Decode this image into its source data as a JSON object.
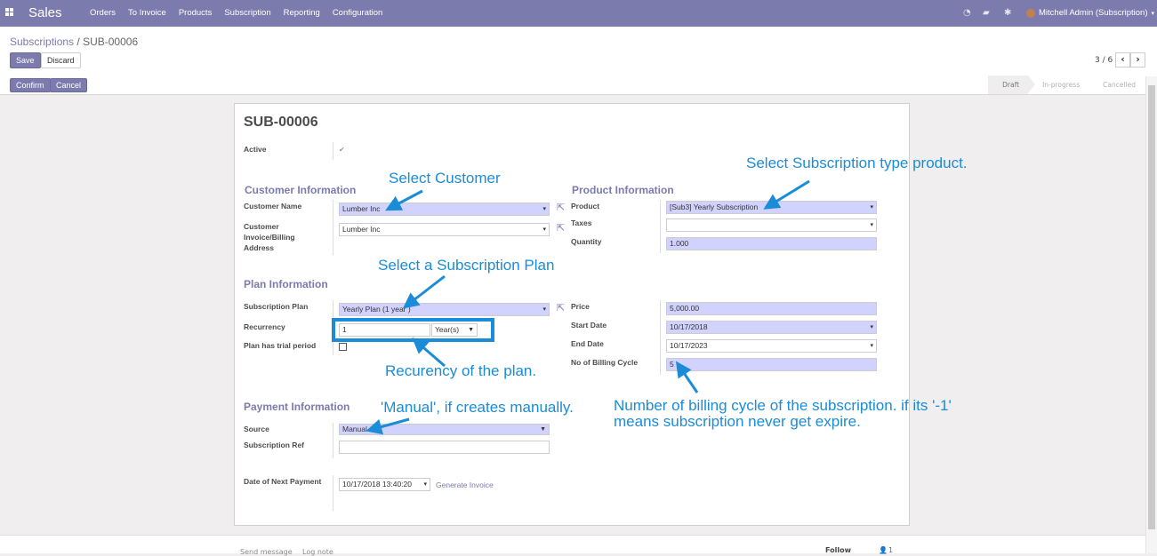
{
  "app": {
    "name": "Sales"
  },
  "nav": {
    "menu": [
      "Orders",
      "To Invoice",
      "Products",
      "Subscription",
      "Reporting",
      "Configuration"
    ],
    "user": "Mitchell Admin (Subscription)"
  },
  "breadcrumb": {
    "parent": "Subscriptions",
    "separator": "/",
    "current": "SUB-00006"
  },
  "buttons": {
    "save": "Save",
    "discard": "Discard",
    "confirm": "Confirm",
    "cancel": "Cancel"
  },
  "pager": {
    "value": "3 / 6"
  },
  "stages": [
    "Draft",
    "In-progress",
    "Cancelled"
  ],
  "form": {
    "title": "SUB-00006",
    "active_label": "Active",
    "customer": {
      "section": "Customer Information",
      "name_label": "Customer Name",
      "name_value": "Lumber Inc",
      "invoice_label_1": "Customer",
      "invoice_label_2": "Invoice/Billing",
      "invoice_label_3": "Address",
      "invoice_value": "Lumber Inc"
    },
    "product": {
      "section": "Product Information",
      "product_label": "Product",
      "product_value": "[Sub3] Yearly Subscription",
      "taxes_label": "Taxes",
      "taxes_value": "",
      "quantity_label": "Quantity",
      "quantity_value": "1.000"
    },
    "plan": {
      "section": "Plan Information",
      "plan_label": "Subscription Plan",
      "plan_value": "Yearly Plan (1 year )",
      "recurrency_label": "Recurrency",
      "recurrency_value": "1",
      "recurrency_unit": "Year(s)",
      "trial_label": "Plan has trial period",
      "price_label": "Price",
      "price_value": "5,000.00",
      "start_label": "Start Date",
      "start_value": "10/17/2018",
      "end_label": "End Date",
      "end_value": "10/17/2023",
      "cycles_label": "No of Billing Cycle",
      "cycles_value": "5"
    },
    "payment": {
      "section": "Payment Information",
      "source_label": "Source",
      "source_value": "Manual",
      "ref_label": "Subscription Ref",
      "ref_value": "",
      "next_label": "Date of Next Payment",
      "next_value": "10/17/2018 13:40:20",
      "generate_invoice": "Generate Invoice"
    }
  },
  "annotations": {
    "customer": "Select Customer",
    "product": "Select Subscription type product.",
    "plan": "Select a Subscription Plan",
    "recurrency": "Recurency of the plan.",
    "manual": "'Manual', if creates manually.",
    "billing_1": "Number of billing cycle of the subscription. if its '-1'",
    "billing_2": "means subscription never get expire."
  },
  "chatter": {
    "send_message": "Send message",
    "log_note": "Log note",
    "follow": "Follow",
    "followers": "1"
  },
  "colors": {
    "brand": "#7c7bad",
    "annotation": "#1a8cd8",
    "required_field": "#d2d2ff"
  }
}
